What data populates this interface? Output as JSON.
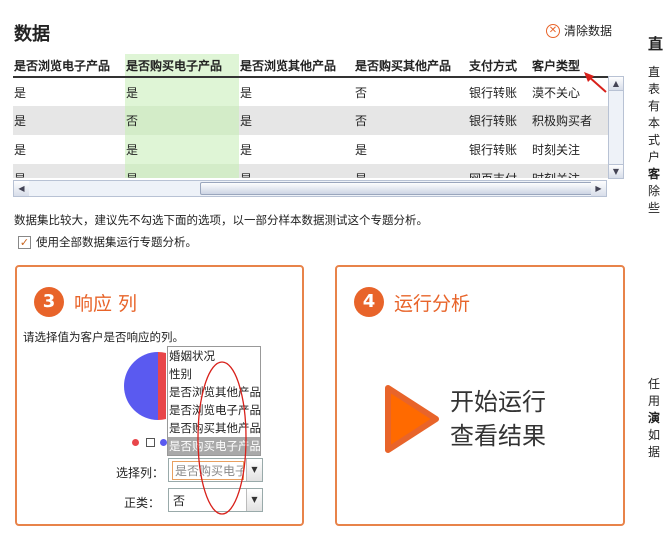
{
  "header": {
    "title": "数据",
    "clear_label": "清除数据"
  },
  "table": {
    "columns": [
      "是否浏览电子产品",
      "是否购买电子产品",
      "是否浏览其他产品",
      "是否购买其他产品",
      "支付方式",
      "客户类型"
    ],
    "rows": [
      [
        "是",
        "是",
        "是",
        "否",
        "银行转账",
        "漠不关心"
      ],
      [
        "是",
        "否",
        "是",
        "否",
        "银行转账",
        "积极购买者"
      ],
      [
        "是",
        "是",
        "是",
        "是",
        "银行转账",
        "时刻关注"
      ],
      [
        "是",
        "是",
        "是",
        "是",
        "网页支付",
        "时刻关注"
      ]
    ]
  },
  "notice": {
    "text": "数据集比较大，建议先不勾选下面的选项，以一部分样本数据测试这个专题分析。",
    "checkbox_label": "使用全部数据集运行专题分析。",
    "checkbox_checked": "✓"
  },
  "step3": {
    "number": "3",
    "title": "响应 列",
    "desc": "请选择值为客户是否响应的列。",
    "options": [
      "婚姻状况",
      "性别",
      "是否浏览其他产品",
      "是否浏览电子产品",
      "是否购买其他产品",
      "是否购买电子产品"
    ],
    "select_label": "选择列：",
    "select_value": "是否购买电子",
    "positive_label": "正类：",
    "positive_value": "否"
  },
  "step4": {
    "number": "4",
    "title": "运行分析",
    "run_line1": "开始运行",
    "run_line2": "查看结果"
  },
  "side": {
    "heading": "直",
    "lines": [
      "直",
      "表",
      "有",
      "本",
      "式",
      "户",
      "客",
      "除",
      "些"
    ],
    "lines2": [
      "任",
      "用",
      "演",
      "如",
      "据"
    ]
  },
  "colors": {
    "accent": "#e8642a",
    "highlight_column": "#dff5d6",
    "pie_blue": "#5a5af0",
    "pie_red": "#e8464a"
  }
}
